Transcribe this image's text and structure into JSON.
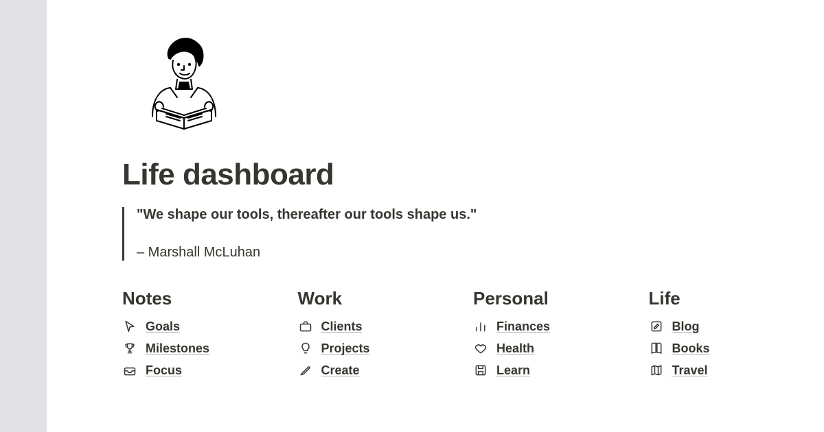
{
  "page": {
    "title": "Life dashboard"
  },
  "quote": {
    "text": "\"We shape our tools, thereafter our tools shape us.\"",
    "author": "– Marshall McLuhan"
  },
  "columns": [
    {
      "title": "Notes",
      "items": [
        {
          "icon": "cursor-icon",
          "label": "Goals"
        },
        {
          "icon": "trophy-icon",
          "label": "Milestones"
        },
        {
          "icon": "inbox-icon",
          "label": "Focus"
        }
      ]
    },
    {
      "title": "Work",
      "items": [
        {
          "icon": "briefcase-icon",
          "label": "Clients"
        },
        {
          "icon": "lightbulb-icon",
          "label": "Projects"
        },
        {
          "icon": "pencil-icon",
          "label": "Create"
        }
      ]
    },
    {
      "title": "Personal",
      "items": [
        {
          "icon": "barchart-icon",
          "label": "Finances"
        },
        {
          "icon": "heart-icon",
          "label": "Health"
        },
        {
          "icon": "save-icon",
          "label": "Learn"
        }
      ]
    },
    {
      "title": "Life",
      "items": [
        {
          "icon": "edit-icon",
          "label": "Blog"
        },
        {
          "icon": "book-icon",
          "label": "Books"
        },
        {
          "icon": "map-icon",
          "label": "Travel"
        }
      ]
    }
  ]
}
